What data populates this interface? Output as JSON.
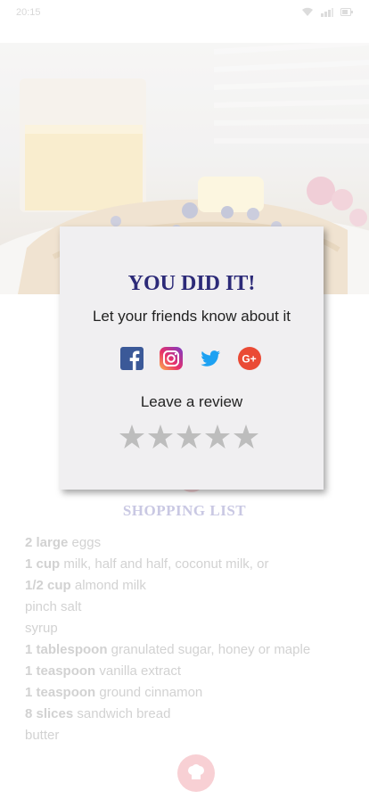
{
  "status_bar": {
    "time": "20:15"
  },
  "share_modal": {
    "title": "YOU DID IT!",
    "subtitle": "Let your friends know about it",
    "social_icons": [
      "facebook-icon",
      "instagram-icon",
      "twitter-icon",
      "google-plus-icon"
    ],
    "review_label": "Leave a review",
    "rating": {
      "value": 0,
      "max": 5
    }
  },
  "shopping_list": {
    "title": "SHOPPING LIST",
    "items": [
      {
        "qty": "2 large",
        "text": " eggs"
      },
      {
        "qty": "1 cup",
        "text": " milk, half and half, coconut milk, or"
      },
      {
        "qty": "1/2 cup",
        "text": " almond milk"
      },
      {
        "qty": "",
        "text": "pinch salt"
      },
      {
        "qty": "",
        "text": "syrup"
      },
      {
        "qty": "1 tablespoon",
        "text": " granulated sugar, honey or maple"
      },
      {
        "qty": "1 teaspoon",
        "text": " vanilla extract"
      },
      {
        "qty": "1 teaspoon",
        "text": " ground cinnamon"
      },
      {
        "qty": "8 slices",
        "text": " sandwich bread"
      },
      {
        "qty": "",
        "text": "butter"
      }
    ]
  },
  "colors": {
    "title": "#2c2a78",
    "star": "#bdbdbd",
    "accent": "#f7c8cd"
  }
}
